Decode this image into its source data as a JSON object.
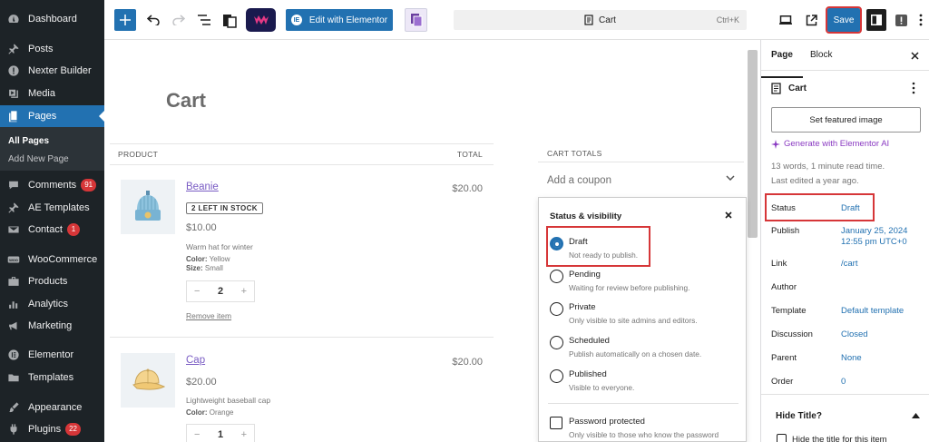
{
  "admin_menu": {
    "items": [
      {
        "label": "Dashboard",
        "icon": "dashboard-icon",
        "badge": ""
      },
      {
        "label": "Posts",
        "icon": "pin-icon",
        "badge": ""
      },
      {
        "label": "Nexter Builder",
        "icon": "nexter-icon",
        "badge": ""
      },
      {
        "label": "Media",
        "icon": "media-icon",
        "badge": ""
      },
      {
        "label": "Pages",
        "icon": "pages-icon",
        "badge": ""
      },
      {
        "label": "Comments",
        "icon": "comment-icon",
        "badge": "91"
      },
      {
        "label": "AE Templates",
        "icon": "pin-icon",
        "badge": ""
      },
      {
        "label": "Contact",
        "icon": "mail-icon",
        "badge": "1"
      },
      {
        "label": "WooCommerce",
        "icon": "woo-icon",
        "badge": ""
      },
      {
        "label": "Products",
        "icon": "products-icon",
        "badge": ""
      },
      {
        "label": "Analytics",
        "icon": "analytics-icon",
        "badge": ""
      },
      {
        "label": "Marketing",
        "icon": "megaphone-icon",
        "badge": ""
      },
      {
        "label": "Elementor",
        "icon": "elementor-icon",
        "badge": ""
      },
      {
        "label": "Templates",
        "icon": "folder-icon",
        "badge": ""
      },
      {
        "label": "Appearance",
        "icon": "brush-icon",
        "badge": ""
      },
      {
        "label": "Plugins",
        "icon": "plugin-icon",
        "badge": "22"
      }
    ],
    "submenu": [
      "All Pages",
      "Add New Page"
    ]
  },
  "toolbar": {
    "edit_elementor": "Edit with Elementor",
    "doc_title": "Cart",
    "shortcut": "Ctrl+K",
    "save": "Save"
  },
  "canvas": {
    "page_title": "Cart",
    "columns": {
      "product": "PRODUCT",
      "total": "TOTAL"
    },
    "items": [
      {
        "name": "Beanie",
        "stock": "2 LEFT IN STOCK",
        "price": "$10.00",
        "desc": "Warm hat for winter",
        "color_label": "Color:",
        "color": "Yellow",
        "size_label": "Size:",
        "size": "Small",
        "qty": "2",
        "remove": "Remove item",
        "total": "$20.00"
      },
      {
        "name": "Cap",
        "price": "$20.00",
        "desc": "Lightweight baseball cap",
        "color_label": "Color:",
        "color": "Orange",
        "qty": "1",
        "total": "$20.00"
      }
    ],
    "qty_minus": "−",
    "qty_plus": "+",
    "cart_totals": "CART TOTALS",
    "coupon": "Add a coupon"
  },
  "popover": {
    "title": "Status & visibility",
    "options": [
      {
        "label": "Draft",
        "help": "Not ready to publish.",
        "selected": true
      },
      {
        "label": "Pending",
        "help": "Waiting for review before publishing."
      },
      {
        "label": "Private",
        "help": "Only visible to site admins and editors."
      },
      {
        "label": "Scheduled",
        "help": "Publish automatically on a chosen date."
      },
      {
        "label": "Published",
        "help": "Visible to everyone."
      }
    ],
    "password_label": "Password protected",
    "password_help": "Only visible to those who know the password"
  },
  "settings": {
    "tabs": [
      "Page",
      "Block"
    ],
    "doc_title": "Cart",
    "featured_image": "Set featured image",
    "generate_ai": "Generate with Elementor AI",
    "words": "13 words, 1 minute read time.",
    "last_edited": "Last edited a year ago.",
    "props": [
      {
        "label": "Status",
        "value": "Draft",
        "value2": ""
      },
      {
        "label": "Publish",
        "value": "January 25, 2024",
        "value2": "12:55 pm UTC+0"
      },
      {
        "label": "Link",
        "value": "/cart",
        "value2": ""
      },
      {
        "label": "Author",
        "value": "",
        "value2": ""
      },
      {
        "label": "Template",
        "value": "Default template",
        "value2": ""
      },
      {
        "label": "Discussion",
        "value": "Closed",
        "value2": ""
      },
      {
        "label": "Parent",
        "value": "None",
        "value2": ""
      },
      {
        "label": "Order",
        "value": "0",
        "value2": ""
      }
    ],
    "hide_title_head": "Hide Title?",
    "hide_title_label": "Hide the title for this item"
  },
  "colors": {
    "wp_blue": "#2271b1",
    "admin_dark": "#1d2327",
    "highlight_red": "#d63638",
    "ai_purple": "#8a3ac2"
  }
}
